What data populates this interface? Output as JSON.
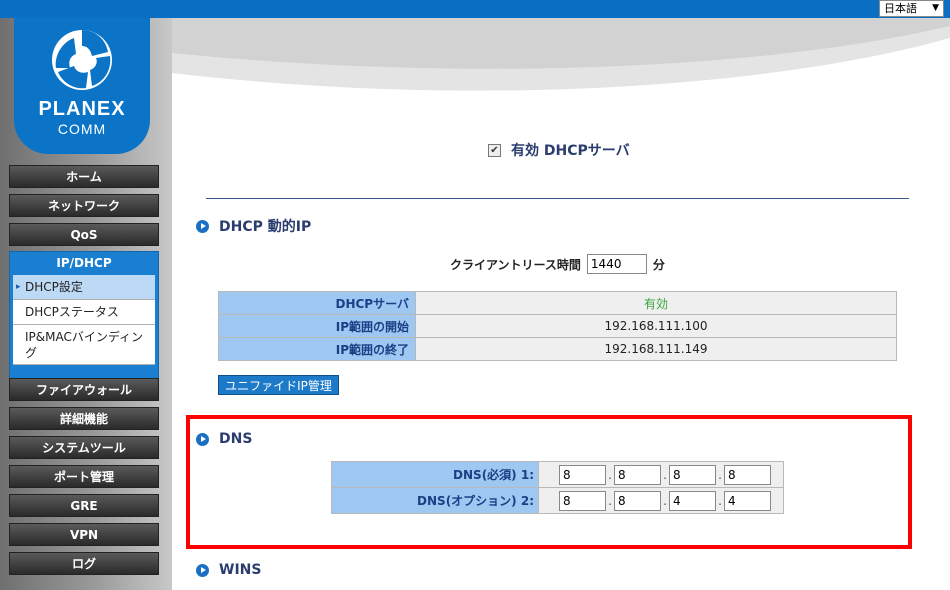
{
  "language": {
    "selected": "日本語"
  },
  "logo": {
    "brand": "PLANEX",
    "sub": "COMM"
  },
  "nav": {
    "home": "ホーム",
    "network": "ネットワーク",
    "qos": "QoS",
    "ip_dhcp": "IP/DHCP",
    "sub_items": [
      "DHCP設定",
      "DHCPステータス",
      "IP&MACバインディング"
    ],
    "firewall": "ファイアウォール",
    "advanced": "詳細機能",
    "system_tools": "システムツール",
    "port_mgmt": "ポート管理",
    "gre": "GRE",
    "vpn": "VPN",
    "log": "ログ"
  },
  "main": {
    "enable_label": "有効 DHCPサーバ",
    "enable_checked": true,
    "dhcp_section_title": "DHCP 動的IP",
    "lease_label": "クライアントリース時間",
    "lease_value": "1440",
    "lease_unit": "分",
    "dhcp_table": [
      {
        "label": "DHCPサーバ",
        "value": "有効"
      },
      {
        "label": "IP範囲の開始",
        "value": "192.168.111.100"
      },
      {
        "label": "IP範囲の終了",
        "value": "192.168.111.149"
      }
    ],
    "unified_button": "ユニファイドIP管理",
    "dns_section_title": "DNS",
    "dns_rows": [
      {
        "label": "DNS(必須) 1:",
        "octets": [
          "8",
          "8",
          "8",
          "8"
        ]
      },
      {
        "label": "DNS(オプション) 2:",
        "octets": [
          "8",
          "8",
          "4",
          "4"
        ]
      }
    ],
    "wins_section_title": "WINS"
  },
  "colors": {
    "accent": "#1a7fd0",
    "highlight": "#ff0000",
    "enabled_green": "#3aa63a",
    "label_text": "#1c3f85"
  }
}
